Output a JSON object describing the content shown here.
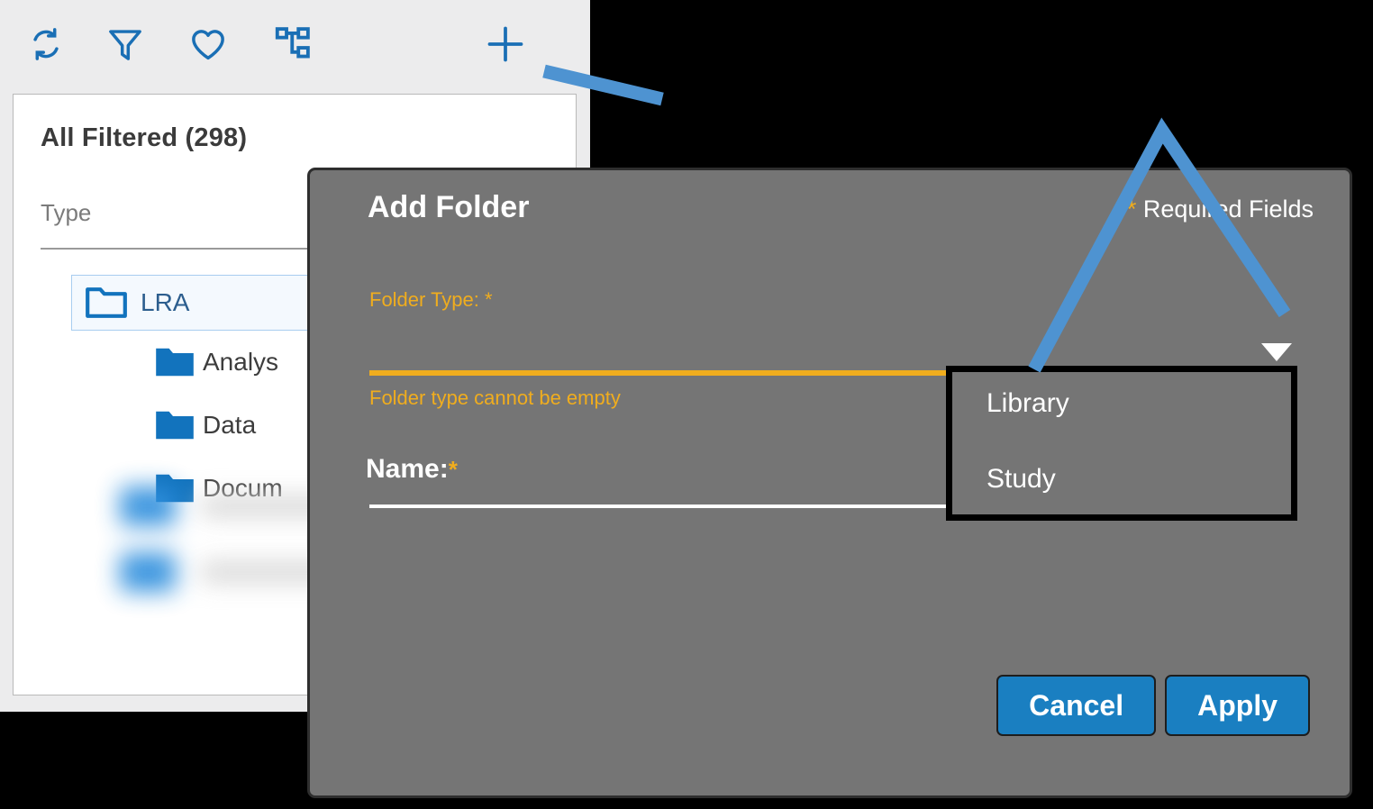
{
  "app": {
    "toolbar": {
      "icons": [
        {
          "name": "refresh-icon",
          "label": "Refresh"
        },
        {
          "name": "filter-icon",
          "label": "Filter"
        },
        {
          "name": "heart-icon",
          "label": "Favorites"
        },
        {
          "name": "hierarchy-icon",
          "label": "Hierarchy"
        },
        {
          "name": "add-icon",
          "label": "Add"
        }
      ],
      "accent_color": "#1a6fb5"
    },
    "list": {
      "title": "All Filtered (298)",
      "count": 298,
      "type_column_label": "Type",
      "tree": [
        {
          "label": "LRA",
          "icon": "folder-outline-icon",
          "selected": true,
          "level": 0
        },
        {
          "label": "Analys",
          "icon": "folder-filled-icon",
          "selected": false,
          "level": 1
        },
        {
          "label": "Data",
          "icon": "folder-filled-icon",
          "selected": false,
          "level": 1
        },
        {
          "label": "Docum",
          "icon": "folder-filled-icon",
          "selected": false,
          "level": 1
        }
      ]
    }
  },
  "dialog": {
    "title": "Add Folder",
    "required_note": "Required Fields",
    "required_star": "*",
    "fields": {
      "folder_type": {
        "label": "Folder Type: *",
        "value": "",
        "error": "Folder type cannot be empty",
        "accent_color": "#f0ad1e"
      },
      "name": {
        "label": "Name:",
        "star": "*",
        "value": ""
      }
    },
    "buttons": {
      "cancel": "Cancel",
      "apply": "Apply",
      "color": "#1a7fc1"
    },
    "background_color": "#757575"
  },
  "dropdown": {
    "open": true,
    "options": [
      "Library",
      "Study"
    ],
    "border_color": "#000000"
  },
  "annotations": {
    "color": "#4e93d1",
    "shapes": [
      "pointer-line-to-add-icon",
      "caret-to-folder-type-dropdown"
    ]
  }
}
